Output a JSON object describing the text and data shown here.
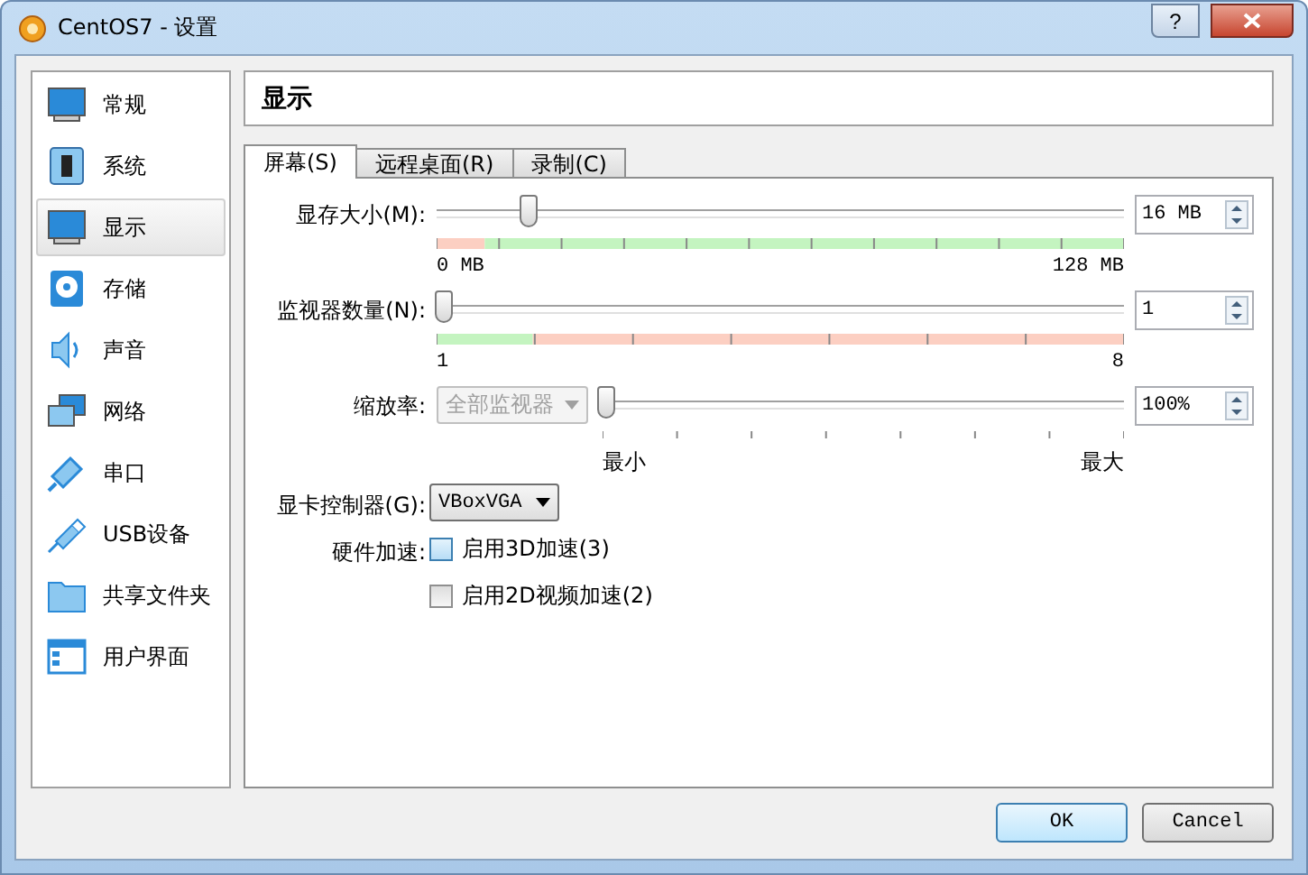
{
  "window": {
    "title": "CentOS7 - 设置",
    "help": "?"
  },
  "sidebar": {
    "items": [
      {
        "label": "常规",
        "kind": "general",
        "selected": false
      },
      {
        "label": "系统",
        "kind": "system",
        "selected": false
      },
      {
        "label": "显示",
        "kind": "display",
        "selected": true
      },
      {
        "label": "存储",
        "kind": "storage",
        "selected": false
      },
      {
        "label": "声音",
        "kind": "audio",
        "selected": false
      },
      {
        "label": "网络",
        "kind": "network",
        "selected": false
      },
      {
        "label": "串口",
        "kind": "serial",
        "selected": false
      },
      {
        "label": "USB设备",
        "kind": "usb",
        "selected": false
      },
      {
        "label": "共享文件夹",
        "kind": "folder",
        "selected": false
      },
      {
        "label": "用户界面",
        "kind": "ui",
        "selected": false
      }
    ]
  },
  "section_title": "显示",
  "tabs": [
    {
      "label": "屏幕(S)",
      "selected": true
    },
    {
      "label": "远程桌面(R)",
      "selected": false
    },
    {
      "label": "录制(C)",
      "selected": false
    }
  ],
  "sliders": [
    {
      "kind": "memory",
      "label": "显存大小(M):",
      "level": 0.125,
      "value": "16 MB",
      "min_label": "0 MB",
      "max_label": "128 MB"
    },
    {
      "kind": "monitors",
      "label": "监视器数量(N):",
      "level": 0,
      "value": "1",
      "min_label": "1",
      "max_label": "8"
    },
    {
      "kind": "scale",
      "label": "缩放率:",
      "select": {
        "value": "全部监视器",
        "disabled": true
      },
      "level": 0,
      "value": "100%",
      "min_label": "最小",
      "max_label": "最大"
    }
  ],
  "graphics_controller": {
    "label": "显卡控制器(G):",
    "value": "VBoxVGA"
  },
  "acceleration": {
    "label": "硬件加速:",
    "options": [
      {
        "label": "启用3D加速(3)",
        "checked": false,
        "focused": true
      },
      {
        "label": "启用2D视频加速(2)",
        "checked": false,
        "focused": false
      }
    ]
  },
  "buttons": [
    {
      "label": "OK",
      "default": true
    },
    {
      "label": "Cancel",
      "default": false
    }
  ]
}
